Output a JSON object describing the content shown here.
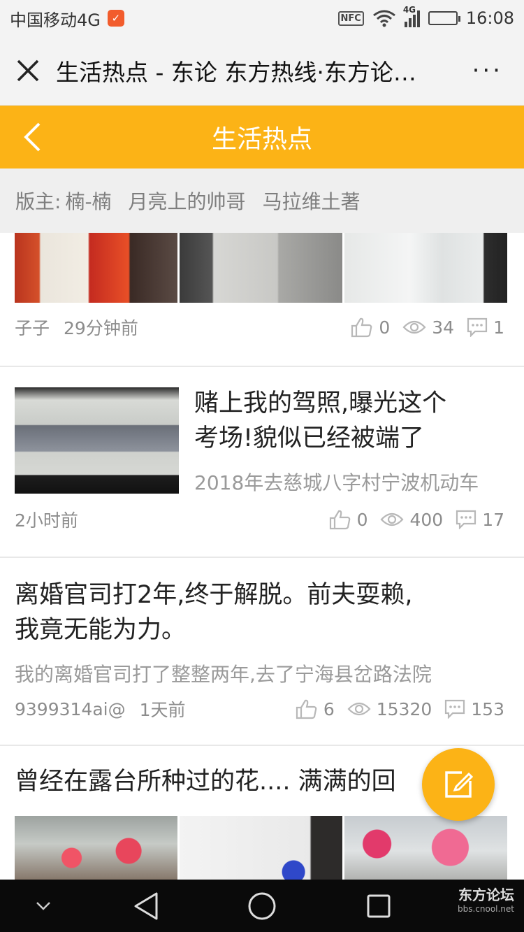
{
  "status_bar": {
    "carrier": "中国移动4G",
    "nfc": "NFC",
    "network": "4G",
    "time": "16:08"
  },
  "titlebar": {
    "title": "生活热点 - 东论 东方热线·东方论…",
    "more": "···"
  },
  "header": {
    "title": "生活热点"
  },
  "moderators": {
    "label": "版主:",
    "names": [
      "楠-楠",
      "月亮上的帅哥",
      "马拉维土著"
    ]
  },
  "posts": [
    {
      "author": "子子",
      "time": "29分钟前",
      "likes": "0",
      "views": "34",
      "comments": "1"
    },
    {
      "title_line1": "赌上我的驾照,曝光这个",
      "title_line2": "考场!貌似已经被端了",
      "excerpt": "2018年去慈城八字村宁波机动车",
      "time": "2小时前",
      "likes": "0",
      "views": "400",
      "comments": "17"
    },
    {
      "title_line1": "离婚官司打2年,终于解脱。前夫耍赖,",
      "title_line2": "我竟无能为力。",
      "excerpt": "我的离婚官司打了整整两年,去了宁海县岔路法院",
      "author": "9399314ai@",
      "time": "1天前",
      "likes": "6",
      "views": "15320",
      "comments": "153"
    },
    {
      "title": "曾经在露台所种过的花.... 满满的回"
    }
  ],
  "watermark": {
    "brand": "东方论坛",
    "url": "bbs.cnool.net"
  },
  "colors": {
    "accent": "#fcb316",
    "meta_gray": "#8c8c8c"
  },
  "icons": [
    "close-icon",
    "more-icon",
    "back-icon",
    "like-icon",
    "view-icon",
    "comment-icon",
    "edit-icon",
    "nav-down-icon",
    "nav-back-icon",
    "nav-home-icon",
    "nav-recent-icon"
  ]
}
